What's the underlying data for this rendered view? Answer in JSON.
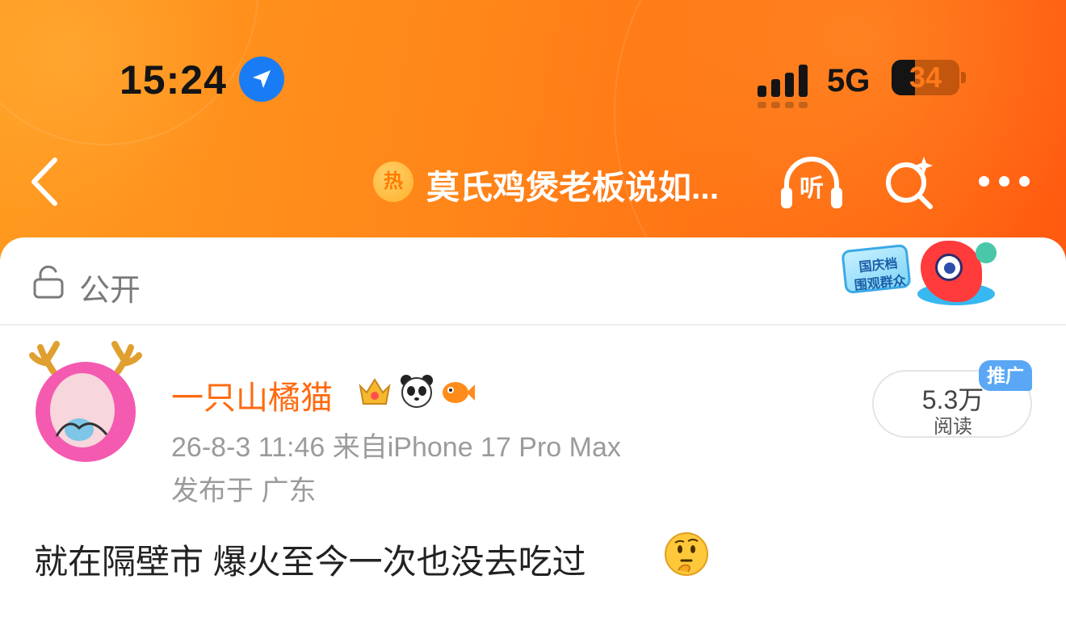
{
  "status_bar": {
    "time": "15:24",
    "network": "5G",
    "battery": "34",
    "battery_level": 0.34,
    "location_icon": "location-arrow-icon",
    "signal_icon": "signal-bars-icon"
  },
  "nav": {
    "hot_badge": "热",
    "title": "莫氏鸡煲老板说如...",
    "listen_label": "听",
    "icons": [
      "back-chevron-icon",
      "headphones-icon",
      "sparkle-search-icon",
      "more-dots-icon"
    ]
  },
  "visibility": {
    "icon": "lock-icon",
    "label": "公开"
  },
  "promo_sticker": {
    "lines": [
      "国庆档",
      "围观群众"
    ]
  },
  "post": {
    "author": "一只山橘猫",
    "badges": [
      "crown-badge-icon",
      "panda-badge-icon",
      "fish-badge-icon"
    ],
    "time_source": "26-8-3 11:46  来自iPhone 17 Pro Max",
    "location": "发布于 广东",
    "reads": "5.3万",
    "reads_label": "阅读",
    "ad_tag": "推广",
    "text": "就在隔壁市 爆火至今一次也没去吃过",
    "emoji": "thinking-face-icon"
  },
  "colors": {
    "header_orange": "#ff8519",
    "accent_orange": "#ff6a10",
    "ad_blue": "#5aa8f5",
    "location_blue": "#1a7cf5"
  }
}
